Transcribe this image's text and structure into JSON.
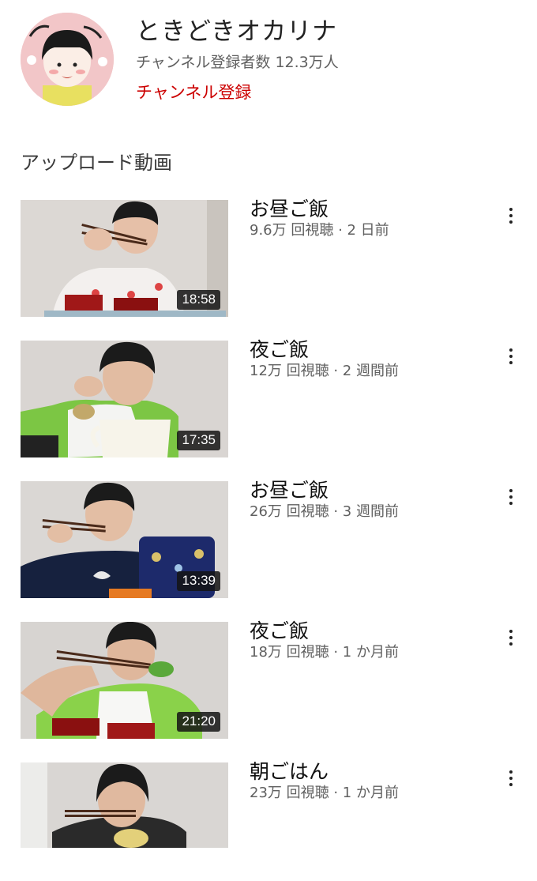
{
  "channel": {
    "name": "ときどきオカリナ",
    "subscribers": "チャンネル登録者数 12.3万人",
    "subscribe_label": "チャンネル登録"
  },
  "section": {
    "title": "アップロード動画"
  },
  "videos": [
    {
      "title": "お昼ご飯",
      "meta": "9.6万 回視聴 · 2 日前",
      "duration": "18:58"
    },
    {
      "title": "夜ご飯",
      "meta": "12万 回視聴 · 2 週間前",
      "duration": "17:35"
    },
    {
      "title": "お昼ご飯",
      "meta": "26万 回視聴 · 3 週間前",
      "duration": "13:39"
    },
    {
      "title": "夜ご飯",
      "meta": "18万 回視聴 · 1 か月前",
      "duration": "21:20"
    },
    {
      "title": "朝ごはん",
      "meta": "23万 回視聴 · 1 か月前",
      "duration": ""
    }
  ],
  "icons": {
    "menu": "more-vert-icon"
  }
}
